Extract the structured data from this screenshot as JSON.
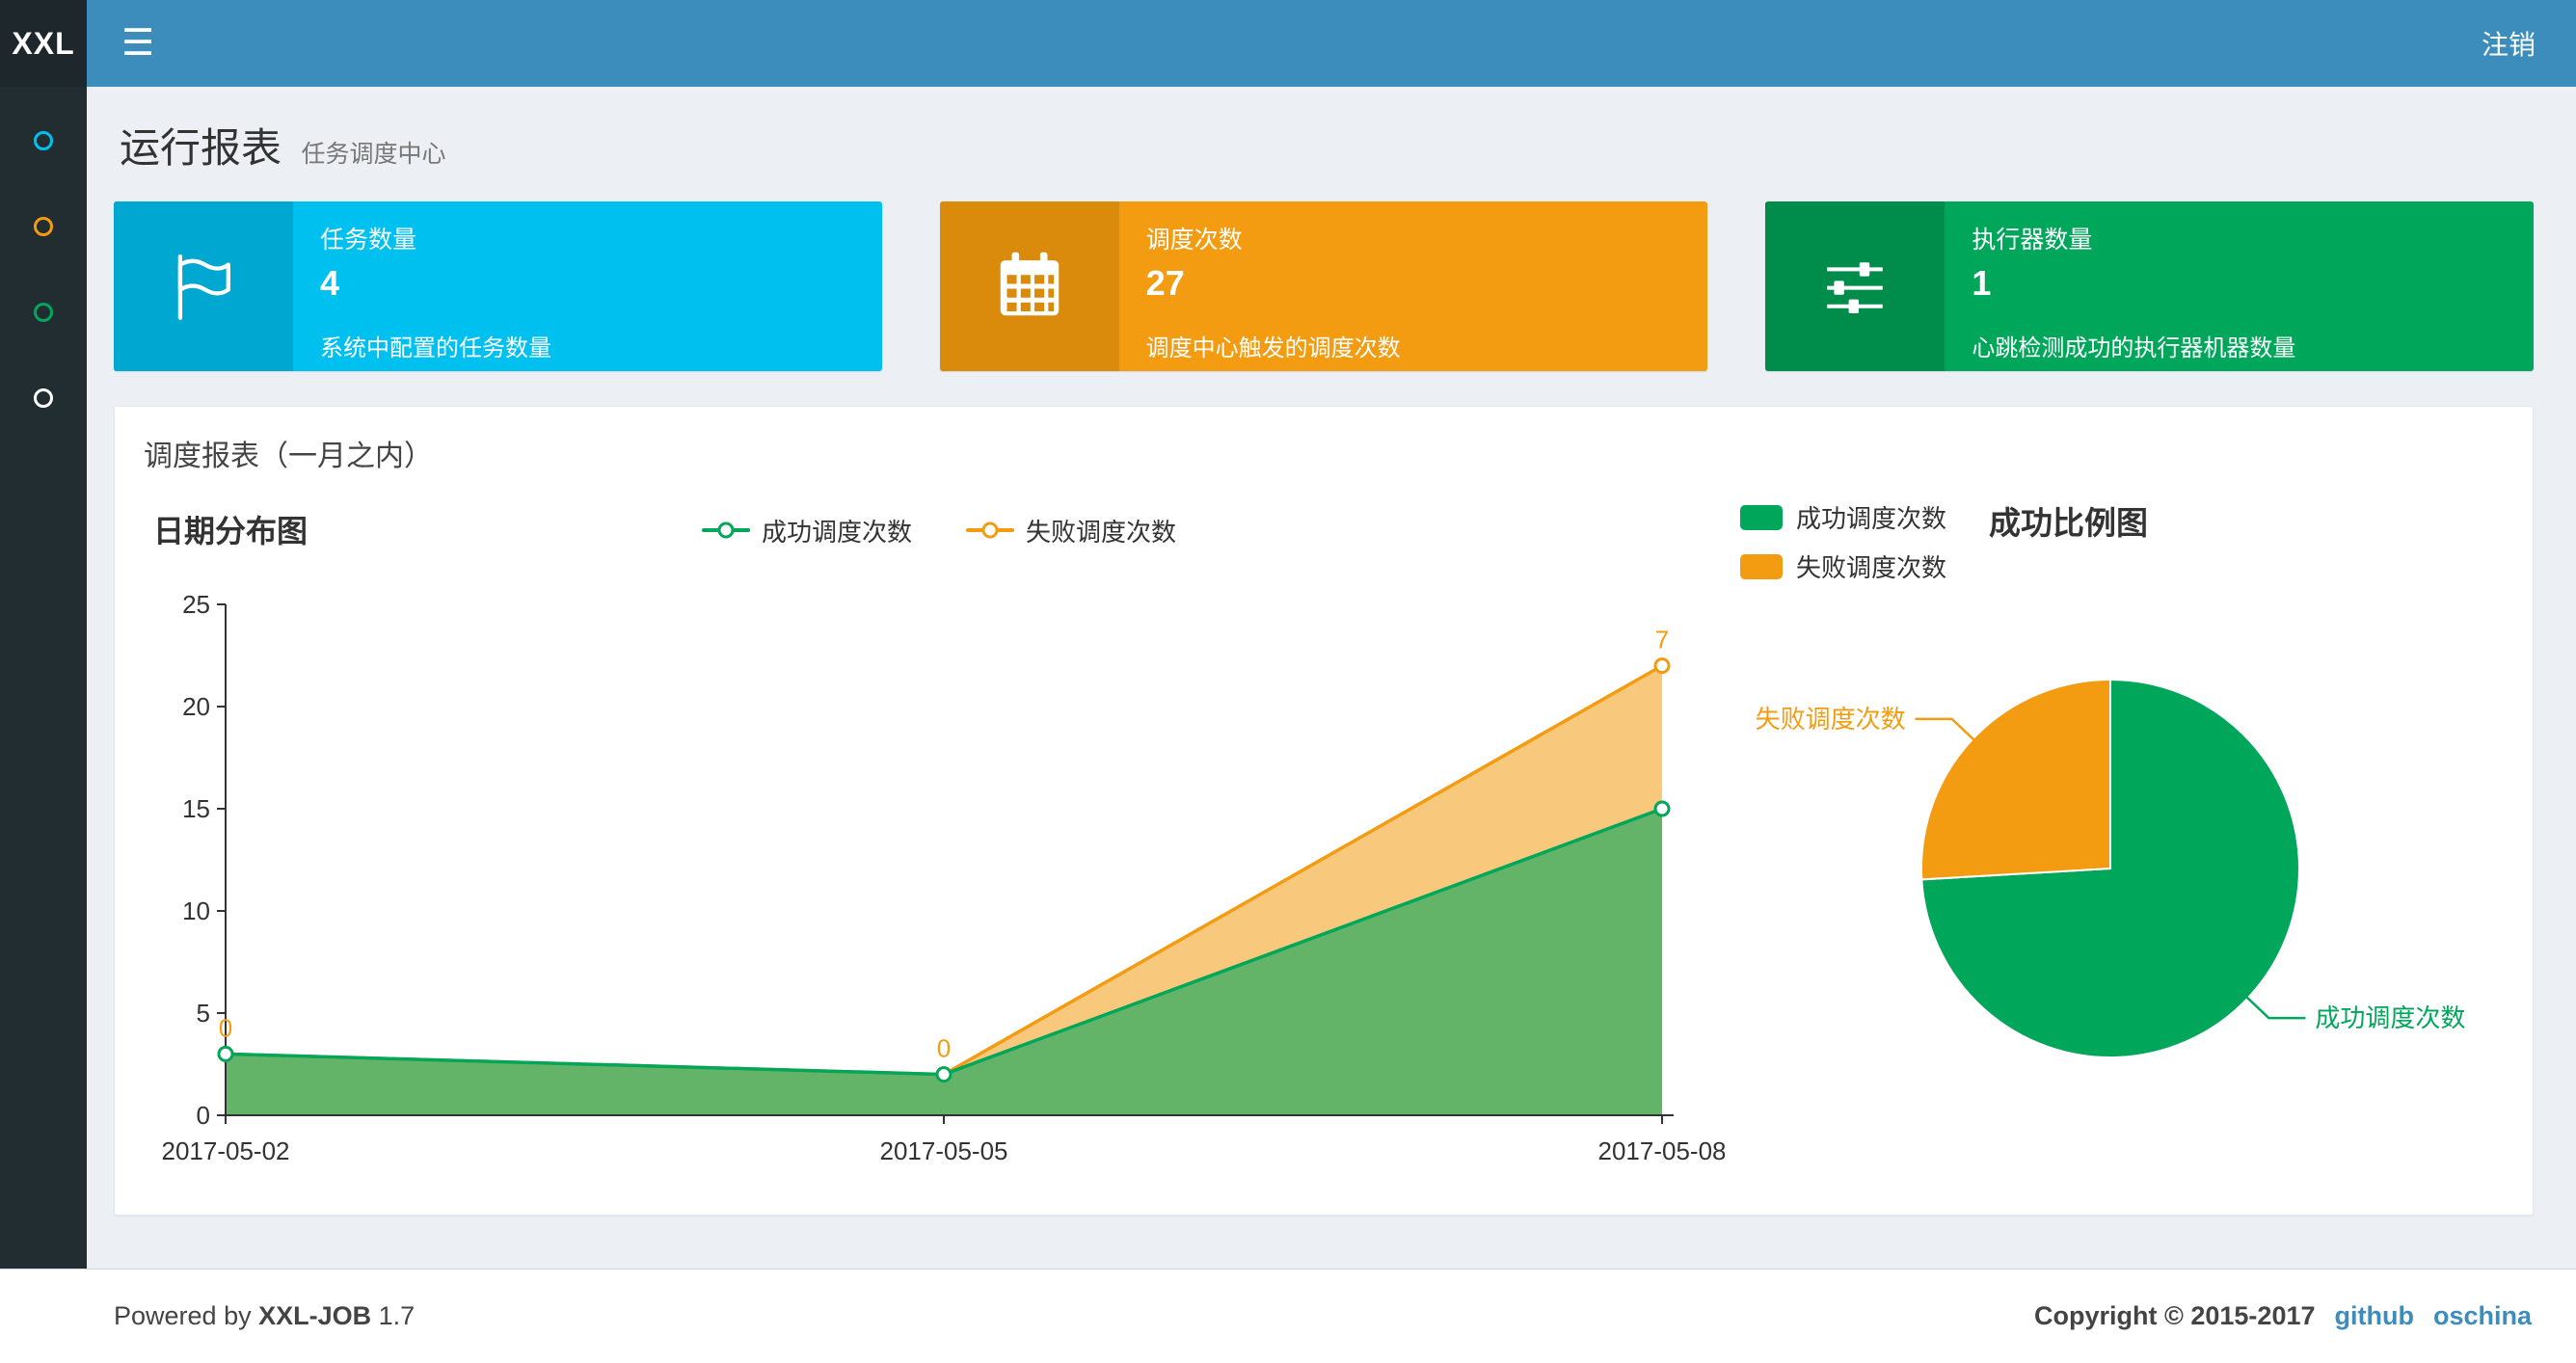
{
  "navbar": {
    "logo": "XXL",
    "menu_icon": "hamburger",
    "logout": "注销"
  },
  "sidebar": {
    "items": [
      {
        "name": "menu-item-1",
        "color": "#00c0ef"
      },
      {
        "name": "menu-item-2",
        "color": "#f39c12"
      },
      {
        "name": "menu-item-3",
        "color": "#00a65a"
      },
      {
        "name": "menu-item-4",
        "color": "#ffffff"
      }
    ]
  },
  "page": {
    "title": "运行报表",
    "subtitle": "任务调度中心"
  },
  "info_boxes": [
    {
      "icon": "flag-icon",
      "title": "任务数量",
      "value": "4",
      "desc": "系统中配置的任务数量",
      "bg": "#00c0ef",
      "icon_bg": "#00a7d0"
    },
    {
      "icon": "calendar-icon",
      "title": "调度次数",
      "value": "27",
      "desc": "调度中心触发的调度次数",
      "bg": "#f39c12",
      "icon_bg": "#db8b0b"
    },
    {
      "icon": "sliders-icon",
      "title": "执行器数量",
      "value": "1",
      "desc": "心跳检测成功的执行器机器数量",
      "bg": "#00a65a",
      "icon_bg": "#008d4c"
    }
  ],
  "panel": {
    "title": "调度报表（一月之内）"
  },
  "chart_data": [
    {
      "type": "area",
      "title": "日期分布图",
      "categories": [
        "2017-05-02",
        "2017-05-05",
        "2017-05-08"
      ],
      "stacked": true,
      "ylim": [
        0,
        25
      ],
      "yticks": [
        0,
        5,
        10,
        15,
        20,
        25
      ],
      "legend_position": "top-center",
      "grid": false,
      "series": [
        {
          "name": "成功调度次数",
          "color": "#00a65a",
          "values": [
            3,
            2,
            15
          ]
        },
        {
          "name": "失败调度次数",
          "color": "#f39c12",
          "values": [
            0,
            0,
            7
          ],
          "point_labels": [
            "0",
            "0",
            "7"
          ]
        }
      ]
    },
    {
      "type": "pie",
      "title": "成功比例图",
      "legend_position": "top-left",
      "slices": [
        {
          "name": "成功调度次数",
          "value": 20,
          "color": "#00a65a"
        },
        {
          "name": "失败调度次数",
          "value": 7,
          "color": "#f39c12"
        }
      ]
    }
  ],
  "footer": {
    "powered_by": "Powered by",
    "product": "XXL-JOB",
    "version": "1.7",
    "copyright": "Copyright © 2015-2017",
    "links": [
      {
        "label": "github"
      },
      {
        "label": "oschina"
      }
    ]
  }
}
